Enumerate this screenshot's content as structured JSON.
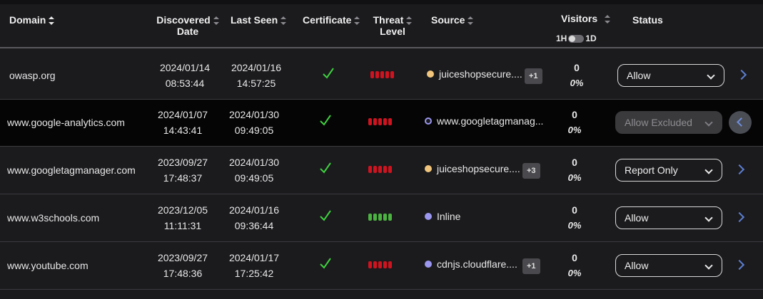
{
  "header": {
    "domain": "Domain",
    "discovered_line1": "Discovered",
    "discovered_line2": "Date",
    "last_seen": "Last Seen",
    "certificate": "Certificate",
    "threat_line1": "Threat",
    "threat_line2": "Level",
    "source": "Source",
    "visitors": "Visitors",
    "toggle_left": "1H",
    "toggle_right": "1D",
    "status": "Status"
  },
  "colors": {
    "check": "#3fd13f",
    "threat_red": "#d0131f",
    "threat_green": "#4bb33f",
    "dot_orange": "#f2c57c",
    "dot_purple": "#9b97f0",
    "arrow_blue": "#5c7fd0"
  },
  "rows": [
    {
      "domain": "owasp.org",
      "discovered_date": "2024/01/14",
      "discovered_time": "08:53:44",
      "last_date": "2024/01/16",
      "last_time": "14:57:25",
      "certificate": "check-icon",
      "threat": "red",
      "source": "juiceshopsecure....",
      "source_dot": "orange",
      "extra": "+1",
      "visitors": "0",
      "percent": "0%",
      "status": "Allow"
    },
    {
      "domain": "www.google-analytics.com",
      "discovered_date": "2024/01/07",
      "discovered_time": "14:43:41",
      "last_date": "2024/01/30",
      "last_time": "09:49:05",
      "certificate": "check-icon",
      "threat": "red",
      "source": "www.googletagmanag...",
      "source_dot": "purple-ring",
      "extra": "",
      "visitors": "0",
      "percent": "0%",
      "status": "Allow Excluded"
    },
    {
      "domain": "www.googletagmanager.com",
      "discovered_date": "2023/09/27",
      "discovered_time": "17:48:37",
      "last_date": "2024/01/30",
      "last_time": "09:49:05",
      "certificate": "check-icon",
      "threat": "red",
      "source": "juiceshopsecure....",
      "source_dot": "orange",
      "extra": "+3",
      "visitors": "0",
      "percent": "0%",
      "status": "Report Only"
    },
    {
      "domain": "www.w3schools.com",
      "discovered_date": "2023/12/05",
      "discovered_time": "11:11:31",
      "last_date": "2024/01/16",
      "last_time": "09:36:44",
      "certificate": "check-icon",
      "threat": "green",
      "source": "Inline",
      "source_dot": "purple",
      "extra": "",
      "visitors": "0",
      "percent": "0%",
      "status": "Allow"
    },
    {
      "domain": "www.youtube.com",
      "discovered_date": "2023/09/27",
      "discovered_time": "17:48:36",
      "last_date": "2024/01/17",
      "last_time": "17:25:42",
      "certificate": "check-icon",
      "threat": "red",
      "source": "cdnjs.cloudflare....",
      "source_dot": "purple",
      "extra": "+1",
      "visitors": "0",
      "percent": "0%",
      "status": "Allow"
    }
  ]
}
